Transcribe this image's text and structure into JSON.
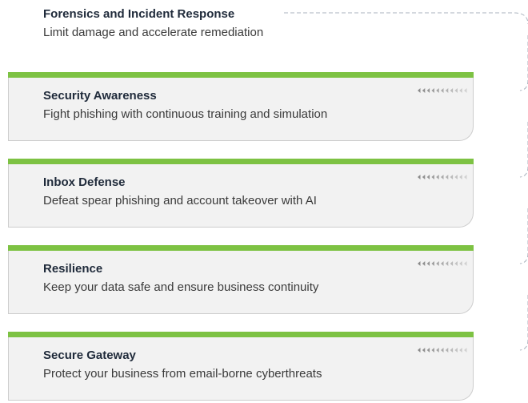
{
  "top_layer": {
    "title": "Forensics and Incident Response",
    "description": "Limit damage and accelerate remediation"
  },
  "layers": [
    {
      "title": "Security Awareness",
      "description": "Fight phishing with continuous training and simulation"
    },
    {
      "title": "Inbox Defense",
      "description": "Defeat spear phishing and account takeover with AI"
    },
    {
      "title": "Resilience",
      "description": "Keep your data safe and ensure business continuity"
    },
    {
      "title": "Secure Gateway",
      "description": "Protect your business from email-borne cyberthreats"
    }
  ],
  "colors": {
    "accent_green": "#7dc243",
    "card_background": "#f2f2f2",
    "card_border": "#cdcdcd",
    "connector": "#a9b2bd",
    "title_text": "#1f2a3a"
  },
  "icons": {
    "flow_arrow": "chevron-left-icon",
    "connector": "dashed-curve-connector"
  }
}
